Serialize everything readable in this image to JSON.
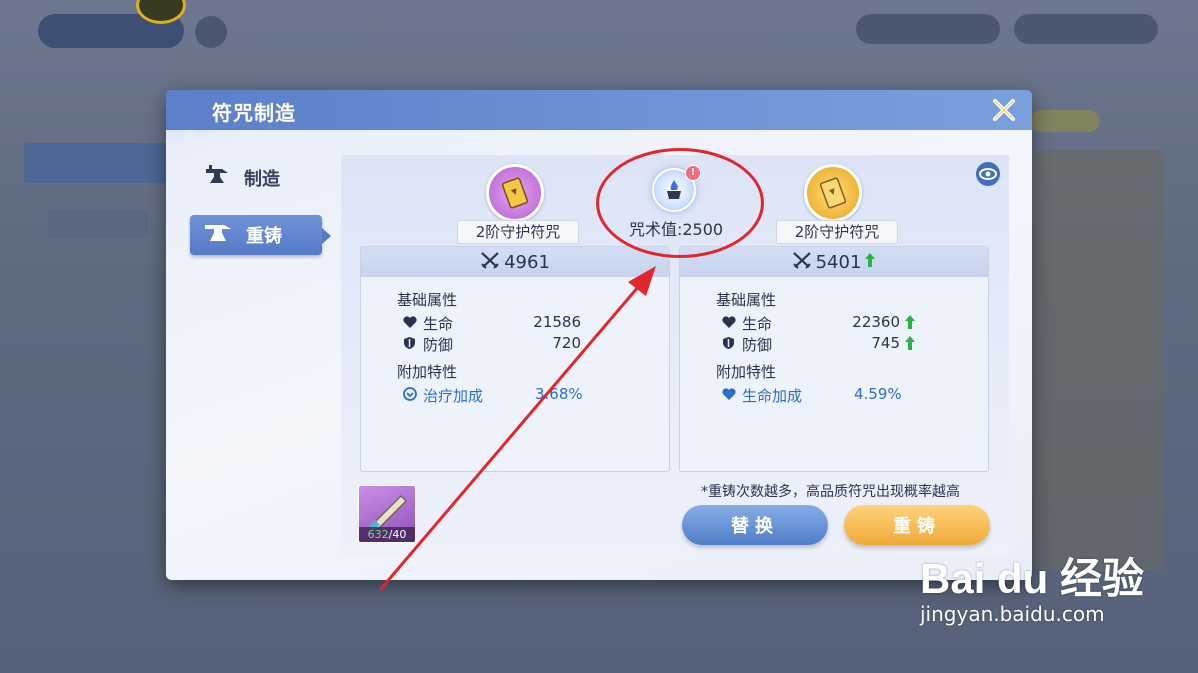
{
  "dialog": {
    "title": "符咒制造"
  },
  "tabs": [
    {
      "label": "制造",
      "icon": "anvil-icon"
    },
    {
      "label": "重铸",
      "icon": "anvil-icon"
    }
  ],
  "spell": {
    "value_text": "咒术值:2500",
    "alert": "!"
  },
  "left_item": {
    "name": "2阶守护符咒",
    "power": "4961",
    "base_title": "基础属性",
    "stats": [
      {
        "label": "生命",
        "value": "21586"
      },
      {
        "label": "防御",
        "value": "720"
      }
    ],
    "extra_title": "附加特性",
    "extra": {
      "label": "治疗加成",
      "value": "3.68%"
    }
  },
  "right_item": {
    "name": "2阶守护符咒",
    "power": "5401",
    "base_title": "基础属性",
    "stats": [
      {
        "label": "生命",
        "value": "22360"
      },
      {
        "label": "防御",
        "value": "745"
      }
    ],
    "extra_title": "附加特性",
    "extra": {
      "label": "生命加成",
      "value": "4.59%"
    }
  },
  "hint": "*重铸次数越多，高品质符咒出现概率越高",
  "material": {
    "current": "632",
    "required": "/40"
  },
  "buttons": {
    "replace": "替换",
    "reforge": "重铸"
  },
  "watermark": {
    "logo": "Bai du 经验",
    "url": "jingyan.baidu.com"
  },
  "colors": {
    "accent": "#557ac6",
    "highlight": "#e3262b",
    "up": "#27b33d",
    "reforge_button": "#f0a93a"
  }
}
